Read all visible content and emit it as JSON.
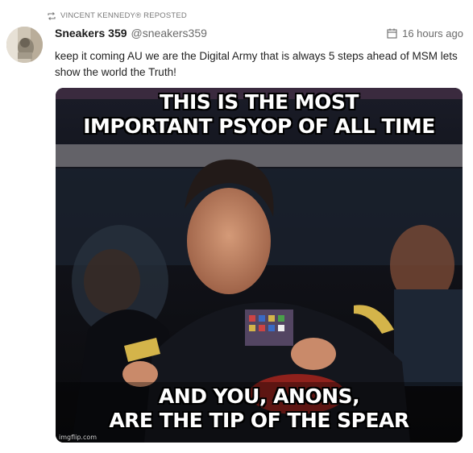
{
  "repost": {
    "text": "VINCENT KENNEDY® REPOSTED",
    "icon": "repost-icon"
  },
  "author": {
    "name": "Sneakers 359",
    "handle": "@sneakers359",
    "avatar_icon": "avatar-image"
  },
  "timestamp": {
    "text": "16 hours ago",
    "icon": "calendar-icon"
  },
  "post": {
    "text": "keep it coming AU we are the Digital Army that is always 5 steps ahead of MSM lets show the world the Truth!"
  },
  "meme": {
    "top_caption_line1": "THIS IS THE MOST",
    "top_caption_line2": "IMPORTANT PSYOP OF ALL TIME",
    "bottom_caption_line1": "AND YOU, ANONS,",
    "bottom_caption_line2": "ARE THE TIP OF THE SPEAR",
    "watermark": "imgflip.com",
    "colors": {
      "background": "#0b0b0f",
      "uniform": "#14161d",
      "skin": "#c98a6a"
    }
  }
}
